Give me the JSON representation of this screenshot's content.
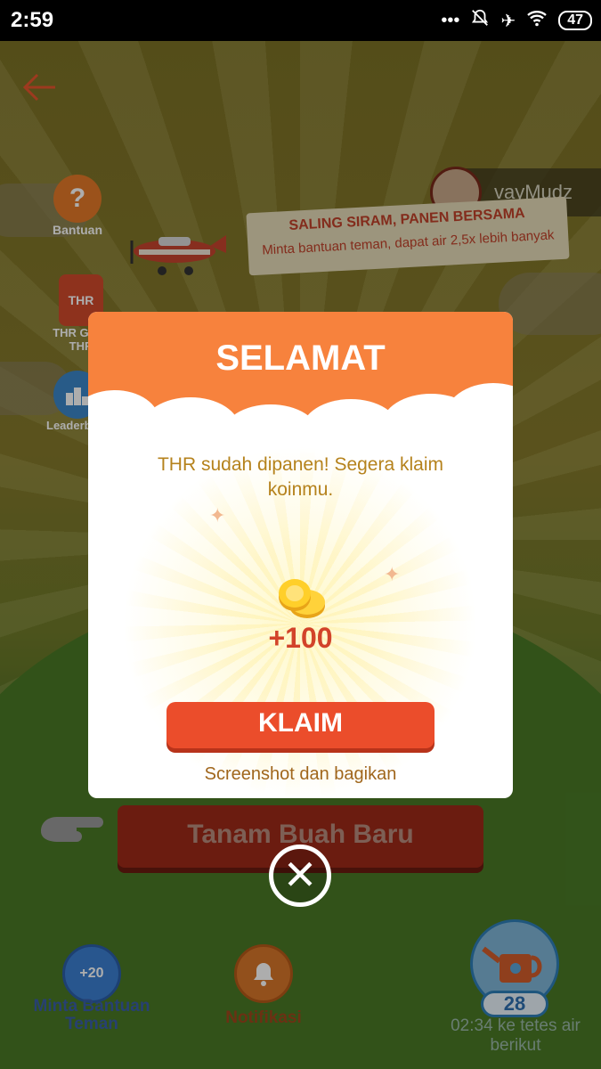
{
  "status_bar": {
    "time": "2:59",
    "battery": "47"
  },
  "game": {
    "side_buttons": [
      {
        "label": "Bantuan"
      },
      {
        "label": "THR\nGanti THR"
      },
      {
        "label": "Leaderboard"
      }
    ],
    "user": {
      "name": "vayMudz"
    },
    "banner": {
      "title": "SALING SIRAM, PANEN BERSAMA",
      "subtitle": "Minta bantuan teman, dapat air 2,5x lebih banyak"
    },
    "plant_button": "Tanam Buah Baru",
    "bottom_nav": {
      "help_badge": "+20",
      "help_label": "Minta Bantuan Teman",
      "notif_label": "Notifikasi",
      "water_count": "28",
      "timer": "02:34 ke tetes air berikut"
    }
  },
  "modal": {
    "title": "SELAMAT",
    "message": "THR sudah dipanen! Segera klaim koinmu.",
    "reward": "+100",
    "claim_label": "KLAIM",
    "share_label": "Screenshot dan bagikan"
  },
  "colors": {
    "accent_orange": "#f7823d",
    "claim_red": "#eb4d2b",
    "message_gold": "#b5821c"
  }
}
